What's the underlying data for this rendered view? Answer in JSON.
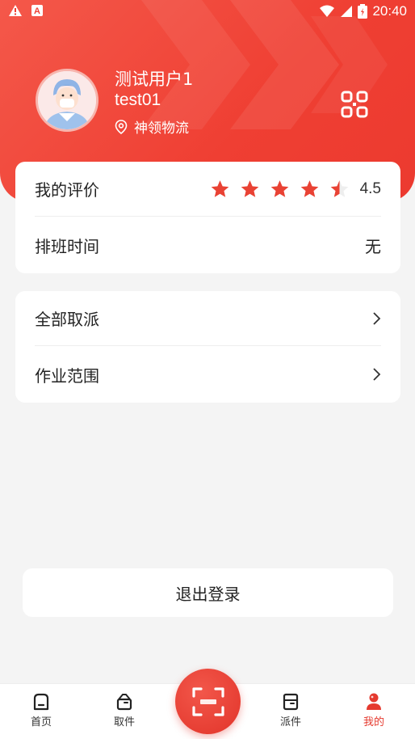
{
  "status_bar": {
    "time": "20:40"
  },
  "profile": {
    "name": "测试用户1",
    "account": "test01",
    "company": "神领物流"
  },
  "evaluation": {
    "label": "我的评价",
    "rating": "4.5",
    "stars": 4.5,
    "max_stars": 5
  },
  "schedule": {
    "label": "排班时间",
    "value": "无"
  },
  "menu": [
    {
      "label": "全部取派"
    },
    {
      "label": "作业范围"
    }
  ],
  "logout_label": "退出登录",
  "tabs": [
    {
      "label": "首页"
    },
    {
      "label": "取件"
    },
    {
      "label": "派件"
    },
    {
      "label": "我的"
    }
  ],
  "colors": {
    "accent": "#ef3f33",
    "background": "#f4f4f4"
  }
}
